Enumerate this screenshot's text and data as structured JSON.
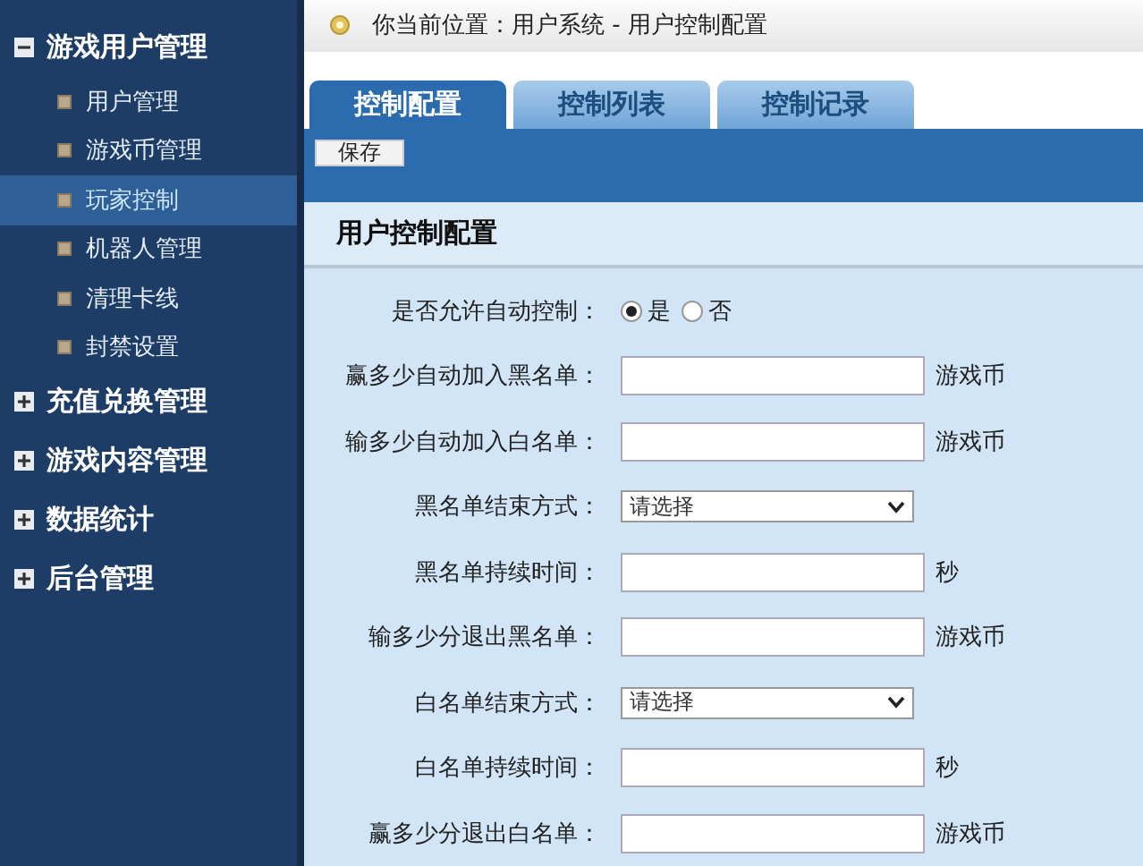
{
  "sidebar": {
    "groups": [
      {
        "label": "游戏用户管理",
        "expanded": true,
        "children": [
          {
            "label": "用户管理",
            "selected": false
          },
          {
            "label": "游戏币管理",
            "selected": false
          },
          {
            "label": "玩家控制",
            "selected": true
          },
          {
            "label": "机器人管理",
            "selected": false
          },
          {
            "label": "清理卡线",
            "selected": false
          },
          {
            "label": "封禁设置",
            "selected": false
          }
        ]
      },
      {
        "label": "充值兑换管理",
        "expanded": false
      },
      {
        "label": "游戏内容管理",
        "expanded": false
      },
      {
        "label": "数据统计",
        "expanded": false
      },
      {
        "label": "后台管理",
        "expanded": false
      }
    ]
  },
  "breadcrumb": "你当前位置：用户系统 - 用户控制配置",
  "tabs": [
    {
      "label": "控制配置",
      "selected": true
    },
    {
      "label": "控制列表",
      "selected": false
    },
    {
      "label": "控制记录",
      "selected": false
    }
  ],
  "toolbar": {
    "save_button": "保存"
  },
  "section_title": "用户控制配置",
  "form": [
    {
      "kind": "radio",
      "label": "是否允许自动控制：",
      "options": [
        {
          "label": "是",
          "selected": true
        },
        {
          "label": "否",
          "selected": false
        }
      ]
    },
    {
      "kind": "input",
      "label": "赢多少自动加入黑名单：",
      "unit": "游戏币"
    },
    {
      "kind": "input",
      "label": "输多少自动加入白名单：",
      "unit": "游戏币"
    },
    {
      "kind": "select",
      "label": "黑名单结束方式：",
      "value": "请选择"
    },
    {
      "kind": "input",
      "label": "黑名单持续时间：",
      "unit": "秒"
    },
    {
      "kind": "input",
      "label": "输多少分退出黑名单：",
      "unit": "游戏币"
    },
    {
      "kind": "select",
      "label": "白名单结束方式：",
      "value": "请选择"
    },
    {
      "kind": "input",
      "label": "白名单持续时间：",
      "unit": "秒"
    },
    {
      "kind": "input",
      "label": "赢多少分退出白名单：",
      "unit": "游戏币"
    }
  ]
}
